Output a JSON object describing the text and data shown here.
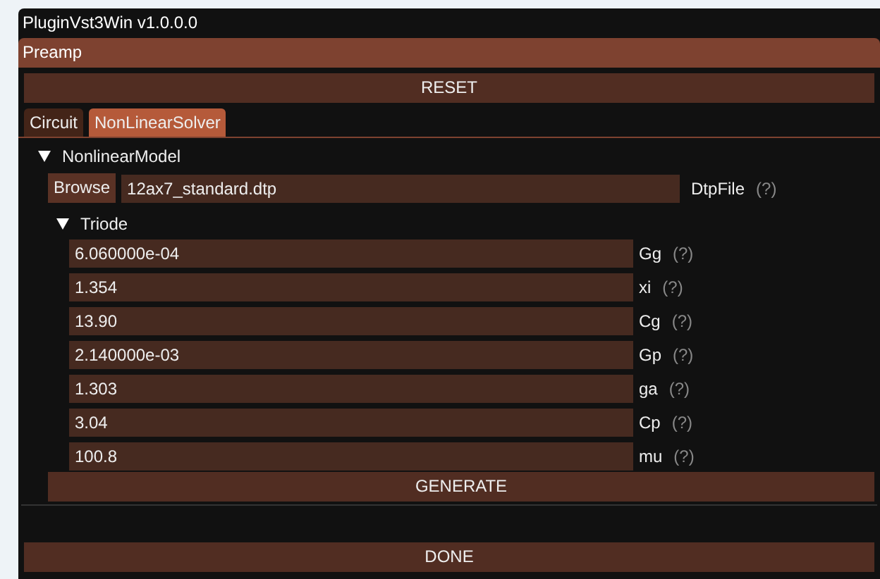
{
  "window": {
    "title": "PluginVst3Win v1.0.0.0"
  },
  "header": {
    "title": "Preamp"
  },
  "reset_button": "RESET",
  "tabs": [
    {
      "label": "Circuit",
      "selected": false
    },
    {
      "label": "NonLinearSolver",
      "selected": true
    }
  ],
  "tree": {
    "label": "NonlinearModel",
    "expanded": true,
    "file": {
      "button": "Browse",
      "value": "12ax7_standard.dtp",
      "label": "DtpFile",
      "help": "(?)"
    },
    "children": [
      {
        "label": "Triode",
        "expanded": true,
        "fields": [
          {
            "value": "6.060000e-04",
            "label": "Gg",
            "help": "(?)"
          },
          {
            "value": "1.354",
            "label": "xi",
            "help": "(?)"
          },
          {
            "value": "13.90",
            "label": "Cg",
            "help": "(?)"
          },
          {
            "value": "2.140000e-03",
            "label": "Gp",
            "help": "(?)"
          },
          {
            "value": "1.303",
            "label": "ga",
            "help": "(?)"
          },
          {
            "value": "3.04",
            "label": "Cp",
            "help": "(?)"
          },
          {
            "value": "100.8",
            "label": "mu",
            "help": "(?)"
          }
        ]
      }
    ]
  },
  "generate_button": "GENERATE",
  "done_button": "DONE"
}
